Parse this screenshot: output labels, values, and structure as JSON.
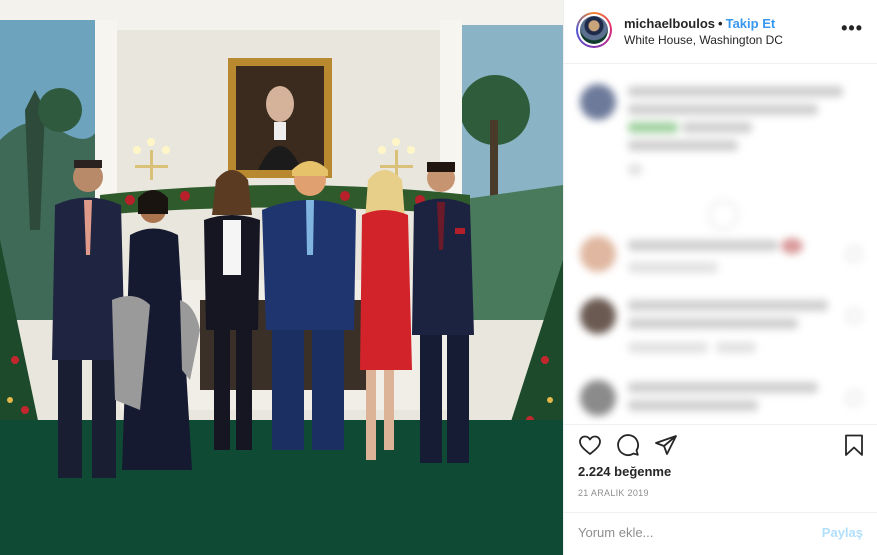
{
  "header": {
    "username": "michaelboulos",
    "separator": "•",
    "follow_label": "Takip Et",
    "location": "White House, Washington DC",
    "more_icon": "•••"
  },
  "photo": {
    "description_icon": "post-photo",
    "colors": {
      "carpet": "#0e4a34",
      "wall": "#e9e6dd",
      "mural_sky": "#6ea3bd"
    }
  },
  "actions": {
    "likes_text": "2.224 beğenme",
    "date_text": "21 ARALIK 2019"
  },
  "comment": {
    "placeholder": "Yorum ekle...",
    "post_label": "Paylaş"
  },
  "colors": {
    "follow": "#3897f0",
    "post_disabled": "#b2dffc",
    "secondary_text": "#8e8e8e"
  }
}
